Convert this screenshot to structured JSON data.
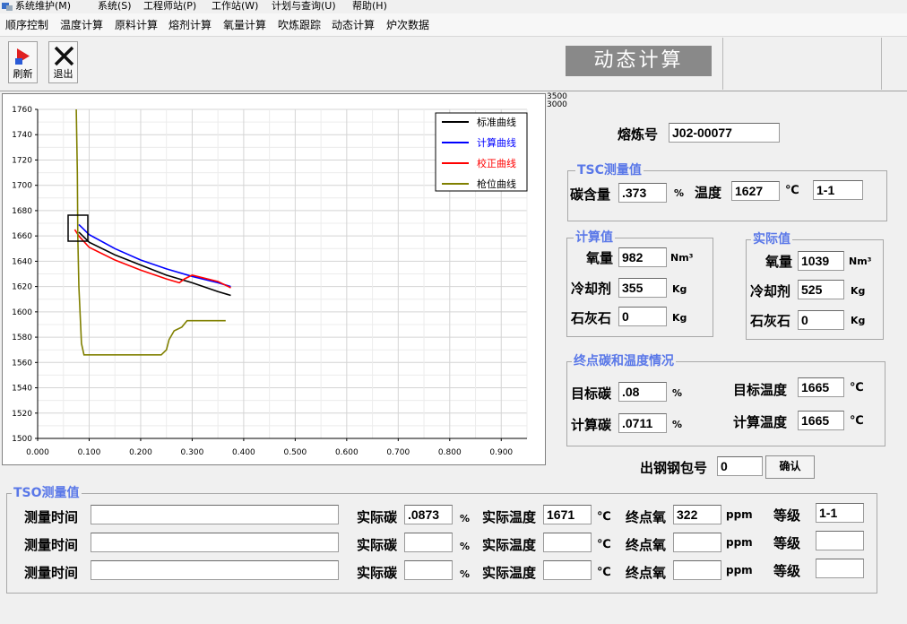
{
  "menu": [
    "系统维护(M)",
    "系统(S)",
    "工程师站(P)",
    "工作站(W)",
    "计划与查询(U)",
    "帮助(H)"
  ],
  "nav": [
    "顺序控制",
    "温度计算",
    "原料计算",
    "熔剂计算",
    "氧量计算",
    "吹炼跟踪",
    "动态计算",
    "炉次数据"
  ],
  "toolbar": {
    "refresh_label": "刷新",
    "exit_label": "退出"
  },
  "page_title": "动态计算",
  "chart_top_labels": [
    "3500",
    "3000"
  ],
  "chart_data": {
    "type": "line",
    "x_ticks": [
      "0.000",
      "0.100",
      "0.200",
      "0.300",
      "0.400",
      "0.500",
      "0.600",
      "0.700",
      "0.800",
      "0.900"
    ],
    "y_ticks": [
      "1760",
      "1740",
      "1720",
      "1700",
      "1680",
      "1660",
      "1640",
      "1620",
      "1600",
      "1580",
      "1560",
      "1540",
      "1520",
      "1500"
    ],
    "xlim": [
      0,
      0.95
    ],
    "ylim": [
      1500,
      1760
    ],
    "grid": true,
    "legend_position": "top-right",
    "series": [
      {
        "name": "标准曲线",
        "color": "#000000",
        "x": [
          0.08,
          0.1,
          0.15,
          0.2,
          0.25,
          0.3,
          0.35,
          0.375
        ],
        "y": [
          1663,
          1655,
          1645,
          1637,
          1629,
          1623,
          1616,
          1613
        ]
      },
      {
        "name": "计算曲线",
        "color": "#0000ff",
        "x": [
          0.08,
          0.1,
          0.15,
          0.2,
          0.25,
          0.3,
          0.35,
          0.375
        ],
        "y": [
          1669,
          1661,
          1650,
          1641,
          1634,
          1628,
          1623,
          1620
        ]
      },
      {
        "name": "校正曲线",
        "color": "#ff0000",
        "x": [
          0.072,
          0.08,
          0.1,
          0.15,
          0.2,
          0.25,
          0.275,
          0.285,
          0.3,
          0.35,
          0.375
        ],
        "y": [
          1665,
          1660,
          1651,
          1641,
          1633,
          1626,
          1623,
          1626,
          1629,
          1624,
          1619
        ]
      },
      {
        "name": "枪位曲线",
        "color": "#808000",
        "x": [
          0.075,
          0.077,
          0.078,
          0.08,
          0.085,
          0.09,
          0.24,
          0.25,
          0.255,
          0.265,
          0.28,
          0.29,
          0.365
        ],
        "y": [
          1760,
          1710,
          1660,
          1620,
          1575,
          1566,
          1566,
          1570,
          1578,
          1585,
          1588,
          1593,
          1593
        ]
      }
    ]
  },
  "heat_no": {
    "label": "熔炼号",
    "value": "J02-00077"
  },
  "tsc": {
    "title": "TSC测量值",
    "carbon_label": "碳含量",
    "carbon_value": ".373",
    "carbon_unit": "%",
    "temp_label": "温度",
    "temp_value": "1627",
    "temp_unit": "℃",
    "grade_value": "1-1"
  },
  "calc": {
    "title": "计算值",
    "oxygen_label": "氧量",
    "oxygen_value": "982",
    "oxygen_unit": "Nm³",
    "coolant_label": "冷却剂",
    "coolant_value": "355",
    "coolant_unit": "Kg",
    "lime_label": "石灰石",
    "lime_value": "0",
    "lime_unit": "Kg"
  },
  "actual": {
    "title": "实际值",
    "oxygen_label": "氧量",
    "oxygen_value": "1039",
    "oxygen_unit": "Nm³",
    "coolant_label": "冷却剂",
    "coolant_value": "525",
    "coolant_unit": "Kg",
    "lime_label": "石灰石",
    "lime_value": "0",
    "lime_unit": "Kg"
  },
  "endpoint": {
    "title": "终点碳和温度情况",
    "target_c_label": "目标碳",
    "target_c_value": ".08",
    "target_c_unit": "%",
    "calc_c_label": "计算碳",
    "calc_c_value": ".0711",
    "calc_c_unit": "%",
    "target_t_label": "目标温度",
    "target_t_value": "1665",
    "target_t_unit": "℃",
    "calc_t_label": "计算温度",
    "calc_t_value": "1665",
    "calc_t_unit": "℃"
  },
  "ladle": {
    "label": "出钢钢包号",
    "value": "0",
    "confirm_label": "确认"
  },
  "tso": {
    "title": "TSO测量值",
    "rows": [
      {
        "time_label": "测量时间",
        "time_value": "",
        "c_label": "实际碳",
        "c_value": ".0873",
        "c_unit": "%",
        "t_label": "实际温度",
        "t_value": "1671",
        "t_unit": "℃",
        "o_label": "终点氧",
        "o_value": "322",
        "o_unit": "ppm",
        "g_label": "等级",
        "g_value": "1-1"
      },
      {
        "time_label": "测量时间",
        "time_value": "",
        "c_label": "实际碳",
        "c_value": "",
        "c_unit": "%",
        "t_label": "实际温度",
        "t_value": "",
        "t_unit": "℃",
        "o_label": "终点氧",
        "o_value": "",
        "o_unit": "ppm",
        "g_label": "等级",
        "g_value": ""
      },
      {
        "time_label": "测量时间",
        "time_value": "",
        "c_label": "实际碳",
        "c_value": "",
        "c_unit": "%",
        "t_label": "实际温度",
        "t_value": "",
        "t_unit": "℃",
        "o_label": "终点氧",
        "o_value": "",
        "o_unit": "ppm",
        "g_label": "等级",
        "g_value": ""
      }
    ]
  }
}
